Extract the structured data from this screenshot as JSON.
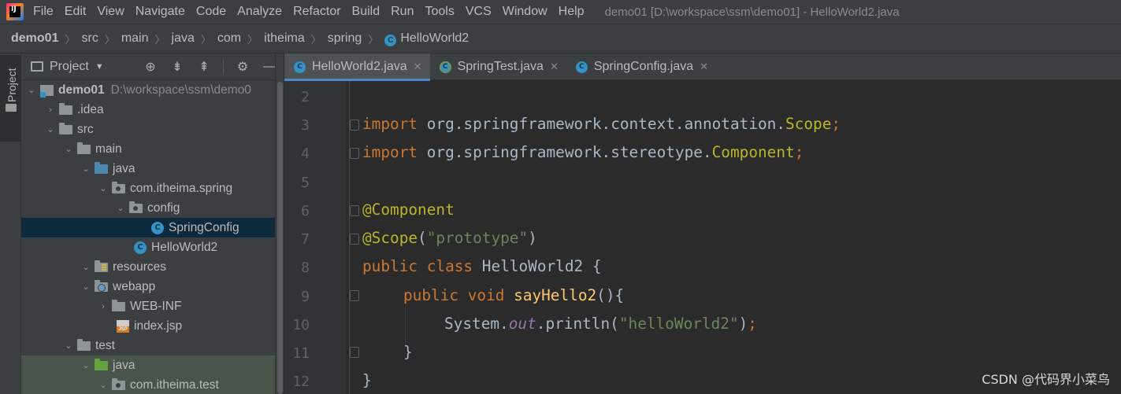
{
  "menubar": {
    "logo_text": "IJ",
    "items": [
      "File",
      "Edit",
      "View",
      "Navigate",
      "Code",
      "Analyze",
      "Refactor",
      "Build",
      "Run",
      "Tools",
      "VCS",
      "Window",
      "Help"
    ],
    "window_title": "demo01 [D:\\workspace\\ssm\\demo01] - HelloWorld2.java"
  },
  "breadcrumb": [
    "demo01",
    "src",
    "main",
    "java",
    "com",
    "itheima",
    "spring",
    "HelloWorld2"
  ],
  "toolstrip": {
    "project_label": "Project"
  },
  "project_panel": {
    "title": "Project",
    "tree": [
      {
        "label": "demo01",
        "path": "D:\\workspace\\ssm\\demo0"
      },
      {
        "label": ".idea"
      },
      {
        "label": "src"
      },
      {
        "label": "main"
      },
      {
        "label": "java"
      },
      {
        "label": "com.itheima.spring"
      },
      {
        "label": "config"
      },
      {
        "label": "SpringConfig"
      },
      {
        "label": "HelloWorld2"
      },
      {
        "label": "resources"
      },
      {
        "label": "webapp"
      },
      {
        "label": "WEB-INF"
      },
      {
        "label": "index.jsp"
      },
      {
        "label": "test"
      },
      {
        "label": "java"
      },
      {
        "label": "com.itheima.test"
      }
    ]
  },
  "tabs": [
    {
      "label": "HelloWorld2.java",
      "active": true
    },
    {
      "label": "SpringTest.java",
      "active": false
    },
    {
      "label": "SpringConfig.java",
      "active": false
    }
  ],
  "editor": {
    "line_numbers": [
      "2",
      "3",
      "4",
      "5",
      "6",
      "7",
      "8",
      "9",
      "10",
      "11",
      "12"
    ],
    "line3": {
      "kw": "import",
      "pkg": " org.springframework.context.annotation.",
      "cls": "Scope",
      "semi": ";"
    },
    "line4": {
      "kw": "import",
      "pkg": " org.springframework.stereotype.",
      "cls": "Component",
      "semi": ";"
    },
    "line6": {
      "ann": "@Component"
    },
    "line7": {
      "ann": "@Scope",
      "open": "(",
      "str": "\"prototype\"",
      "close": ")"
    },
    "line8": {
      "kw1": "public",
      "kw2": " class",
      "rest": " HelloWorld2 {"
    },
    "line9": {
      "kw1": "public",
      "kw2": " void",
      "fn": " sayHello2",
      "rest": "(){"
    },
    "line10": {
      "obj": "System.",
      "field": "out",
      "call": ".println(",
      "str": "\"helloWorld2\"",
      "end": ")",
      "semi": ";"
    },
    "line11": {
      "text": "}"
    },
    "line12": {
      "text": "}"
    }
  },
  "colors": {
    "keyword": "#cc7832",
    "annotation": "#bbb529",
    "string": "#6a8759",
    "method": "#ffc66d",
    "static_field": "#9876aa",
    "plain": "#a9b7c6",
    "selection": "#0d293e",
    "active_tab_underline": "#4a88c7"
  },
  "watermark": "CSDN @代码界小菜鸟"
}
